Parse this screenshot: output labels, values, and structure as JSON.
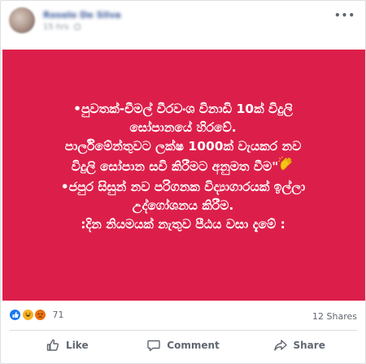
{
  "post": {
    "author": "Roselo De Silva",
    "time": "15 hrs",
    "more_glyph": "•••",
    "background": "#dc1f4a",
    "lines": [
      "•පුවතක්-චීමල් වීරවංශ විනාඩි 10ක් විදුලි",
      "සෝපානයේ හිරවේ.",
      "පාර්ලිමේන්තුවට ලක්ෂ 1000ක් වැයකර නව",
      "විදුලි සෝපාන සවි කිරීමට අනුමත වීම\"",
      "•ජපුර සිසුන් නව පරිගනක විද්‍යාගාරයක් ඉල්ලා",
      "උද්ගෝශනය කිරීම.",
      ":දින නියමයක් නැතුව පීඨය වසා දැමේ :"
    ],
    "emoji_icon": "clapping-hands-icon"
  },
  "stats": {
    "reaction_icons": [
      "like-icon",
      "haha-icon",
      "angry-icon"
    ],
    "reaction_count": "71",
    "shares": "12 Shares"
  },
  "actions": {
    "like": "Like",
    "comment": "Comment",
    "share": "Share"
  }
}
